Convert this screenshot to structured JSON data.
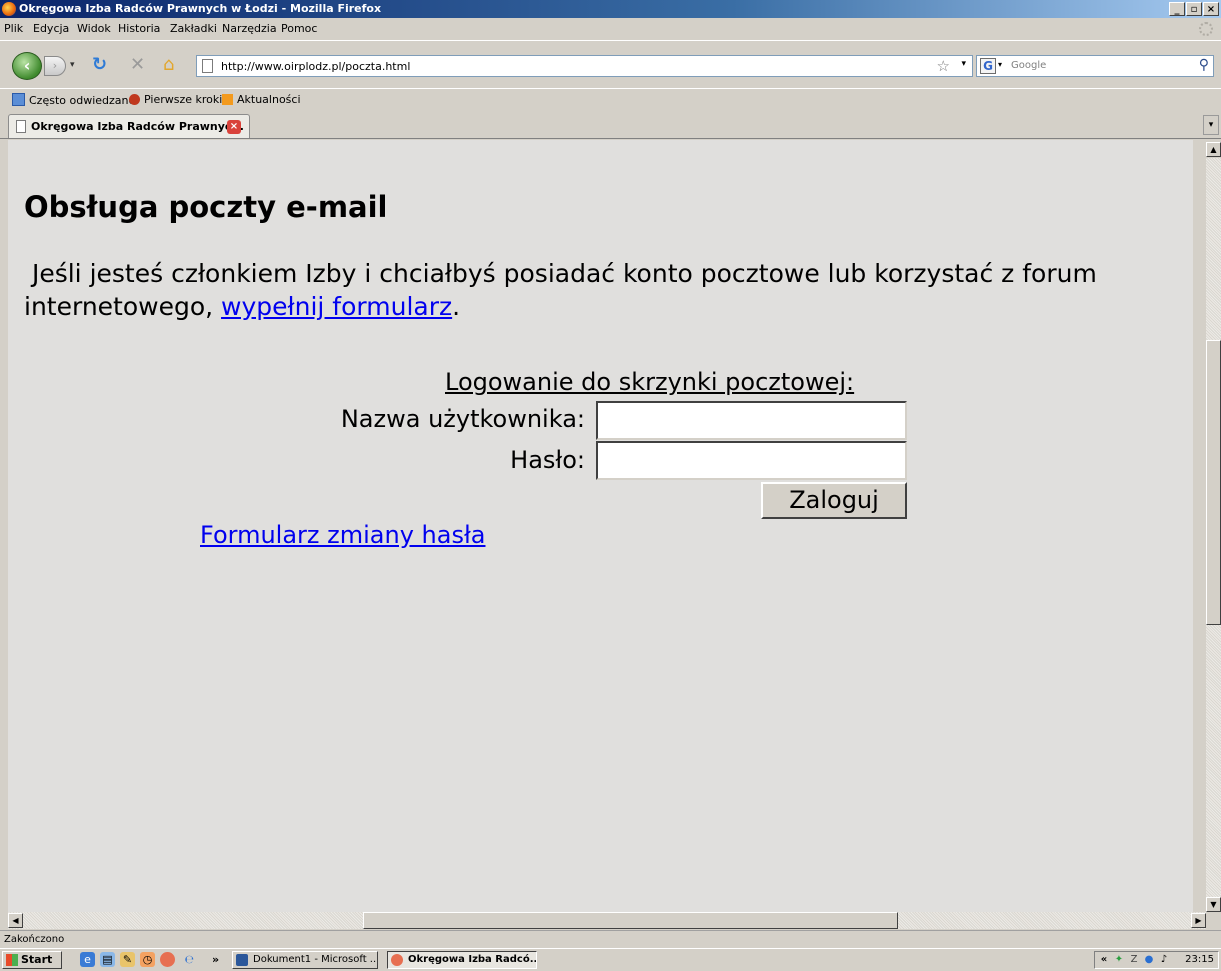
{
  "window": {
    "title": "Okręgowa Izba Radców Prawnych w Łodzi - Mozilla Firefox",
    "min": "_",
    "max": "▫",
    "close": "×"
  },
  "menu": {
    "items": [
      "Plik",
      "Edycja",
      "Widok",
      "Historia",
      "Zakładki",
      "Narzędzia",
      "Pomoc"
    ]
  },
  "navigation": {
    "url": "http://www.oirplodz.pl/poczta.html",
    "search_placeholder": "Google",
    "search_engine_icon": "G"
  },
  "bookmarks": {
    "items": [
      "Często odwiedzane",
      "Pierwsze kroki",
      "Aktualności"
    ]
  },
  "tabs": [
    {
      "label": "Okręgowa Izba Radców Prawnyc..."
    }
  ],
  "page": {
    "title": "Obsługa poczty e-mail",
    "intro_before": " Jeśli jesteś członkiem Izby i chciałbyś posiadać konto pocztowe lub korzystać z forum internetowego, ",
    "intro_link": "wypełnij formularz",
    "intro_after": ".",
    "login_heading": "Logowanie do skrzynki pocztowej:",
    "username_label": "Nazwa użytkownika:",
    "password_label": "Hasło:",
    "username_value": "",
    "password_value": "",
    "login_button": "Zaloguj",
    "change_password_link": "Formularz zmiany hasła"
  },
  "status": {
    "text": "Zakończono"
  },
  "taskbar": {
    "start": "Start",
    "more": "»",
    "tasks": [
      "Dokument1 - Microsoft ...",
      "Okręgowa Izba Radcó..."
    ],
    "tray_more": "«",
    "clock": "23:15"
  },
  "colors": {
    "link": "#0000ee",
    "content_bg": "#e0dfdd",
    "chrome_bg": "#d4d0c8",
    "titlebar": "#0a246a"
  }
}
